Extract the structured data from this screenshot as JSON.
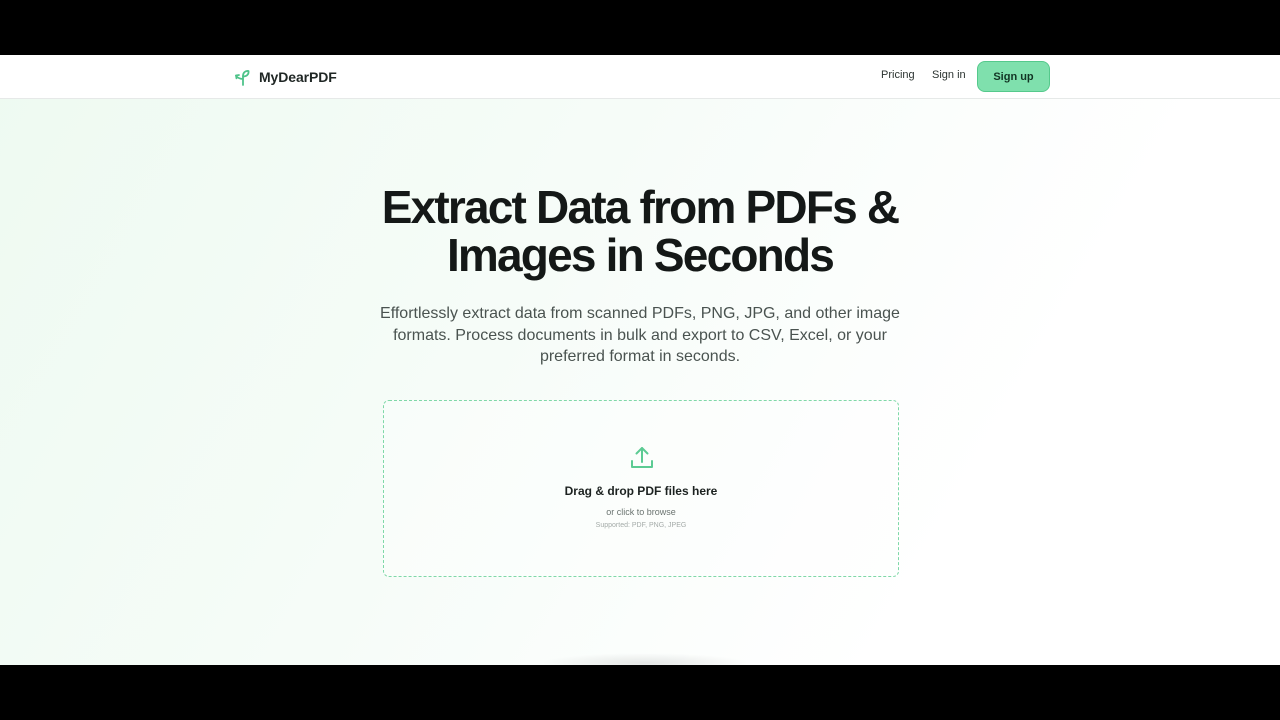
{
  "brand": {
    "name": "MyDearPDF",
    "logo_icon": "leaf-arrow-icon",
    "accent_color": "#7fe0ad"
  },
  "nav": {
    "pricing": "Pricing",
    "sign_in": "Sign in",
    "sign_up": "Sign up"
  },
  "hero": {
    "title": "Extract Data from PDFs & Images in Seconds",
    "subtitle": "Effortlessly extract data from scanned PDFs, PNG, JPG, and other image formats. Process documents in bulk and export to CSV, Excel, or your preferred format in seconds."
  },
  "dropzone": {
    "icon": "upload-icon",
    "title": "Drag & drop PDF files here",
    "browse": "or click to browse",
    "supported": "Supported: PDF, PNG, JPEG"
  }
}
